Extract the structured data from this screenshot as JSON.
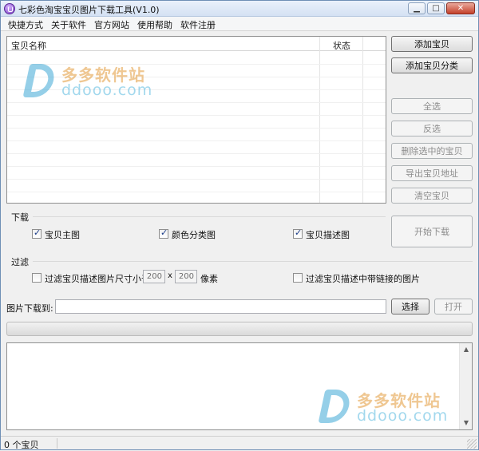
{
  "window": {
    "title": "七彩色淘宝宝贝图片下载工具(V1.0)"
  },
  "menu": [
    "快捷方式",
    "关于软件",
    "官方网站",
    "使用帮助",
    "软件注册"
  ],
  "list": {
    "col_name": "宝贝名称",
    "col_status": "状态"
  },
  "buttons": {
    "add_item": "添加宝贝",
    "add_category": "添加宝贝分类",
    "select_all": "全选",
    "invert": "反选",
    "delete_selected": "删除选中的宝贝",
    "export_address": "导出宝贝地址",
    "clear": "清空宝贝",
    "start_download": "开始下载",
    "choose": "选择",
    "open": "打开"
  },
  "download": {
    "label": "下载",
    "main_image": "宝贝主图",
    "color_image": "颜色分类图",
    "desc_image": "宝贝描述图"
  },
  "filter": {
    "label": "过滤",
    "size_filter_label": "过滤宝贝描述图片尺寸小于:",
    "width": "200",
    "times": "x",
    "height": "200",
    "unit": "像素",
    "link_filter_label": "过滤宝贝描述中带链接的图片"
  },
  "path": {
    "label": "图片下载到:",
    "value": ""
  },
  "status": {
    "count": "0 个宝贝"
  },
  "watermark": {
    "cn": "多多软件站",
    "en": "ddooo.com"
  }
}
